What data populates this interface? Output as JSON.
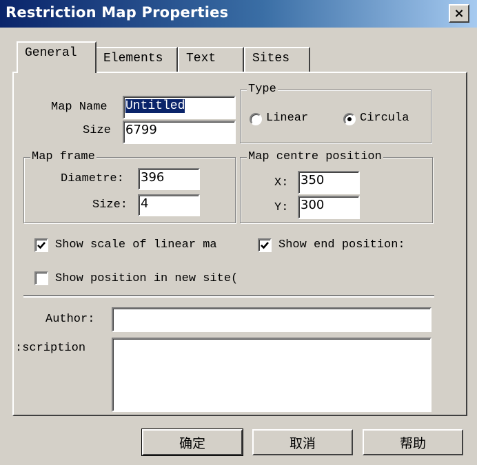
{
  "window": {
    "title": "Restriction Map Properties",
    "close_icon": "×"
  },
  "tabs": [
    {
      "label": "General",
      "active": true
    },
    {
      "label": "Elements",
      "active": false
    },
    {
      "label": "Text",
      "active": false
    },
    {
      "label": "Sites",
      "active": false
    }
  ],
  "general": {
    "map_name_label": "Map Name",
    "map_name_value": "Untitled",
    "size_label": "Size",
    "size_value": "6799",
    "type": {
      "legend": "Type",
      "options": [
        "Linear",
        "Circula"
      ],
      "selected": "Circula"
    },
    "map_frame": {
      "legend": "Map frame",
      "diametre_label": "Diametre:",
      "diametre_value": "396",
      "size_label": "Size:",
      "size_value": "4"
    },
    "centre": {
      "legend": "Map centre position",
      "x_label": "X:",
      "x_value": "350",
      "y_label": "Y:",
      "y_value": "300"
    },
    "checkboxes": [
      {
        "label": "Show scale of linear ma",
        "checked": true
      },
      {
        "label": "Show end position:",
        "checked": true
      },
      {
        "label": "Show position in new site(",
        "checked": false
      }
    ],
    "author_label": "Author:",
    "author_value": "",
    "description_label": ":scription",
    "description_value": ""
  },
  "buttons": {
    "ok": "确定",
    "cancel": "取消",
    "help": "帮助"
  }
}
